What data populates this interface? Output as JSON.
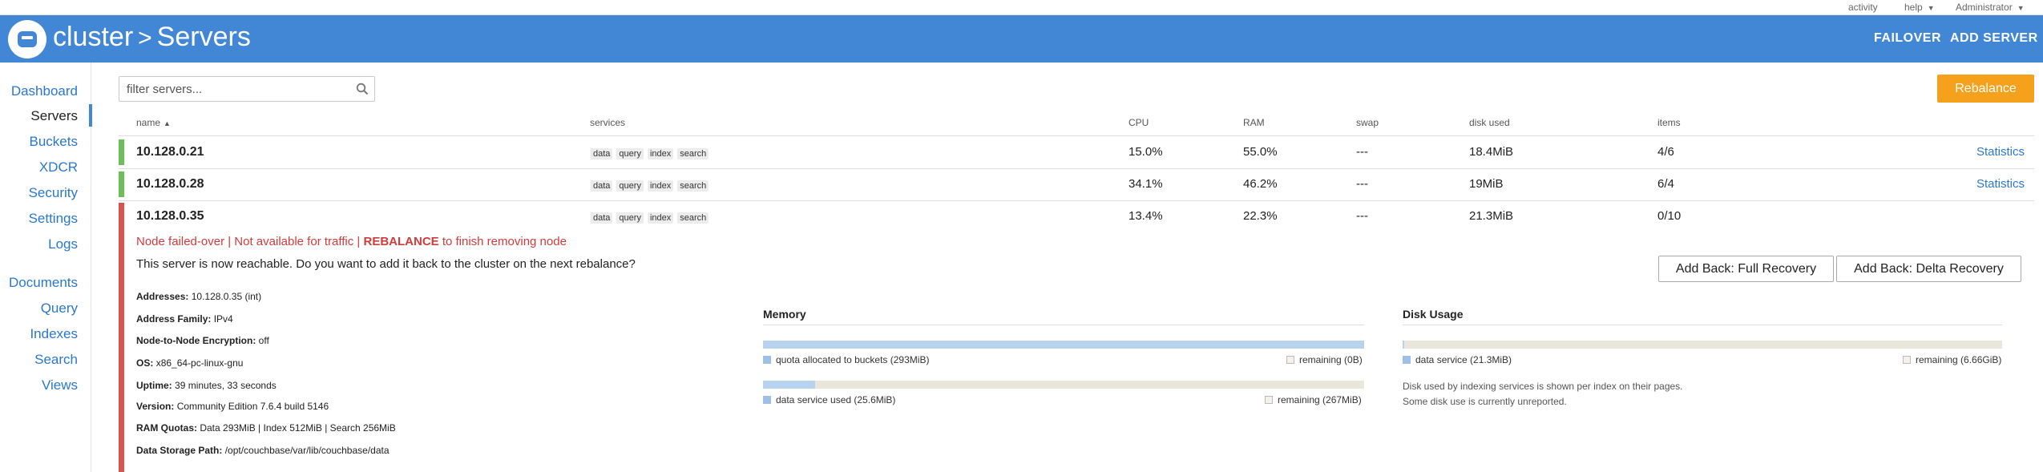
{
  "topbar": {
    "activity": "activity",
    "help": "help",
    "user": "Administrator"
  },
  "header": {
    "cluster": "cluster",
    "separator": ">",
    "page": "Servers",
    "failover": "FAILOVER",
    "add_server": "ADD SERVER"
  },
  "nav": {
    "items": [
      {
        "label": "Dashboard"
      },
      {
        "label": "Servers"
      },
      {
        "label": "Buckets"
      },
      {
        "label": "XDCR"
      },
      {
        "label": "Security"
      },
      {
        "label": "Settings"
      },
      {
        "label": "Logs"
      },
      {
        "label": "Documents"
      },
      {
        "label": "Query"
      },
      {
        "label": "Indexes"
      },
      {
        "label": "Search"
      },
      {
        "label": "Views"
      }
    ],
    "active": "Servers"
  },
  "filter": {
    "placeholder": "filter servers..."
  },
  "rebalance_label": "Rebalance",
  "columns": {
    "name": "name",
    "services": "services",
    "cpu": "CPU",
    "ram": "RAM",
    "swap": "swap",
    "disk": "disk used",
    "items": "items"
  },
  "servers": [
    {
      "name": "10.128.0.21",
      "services": [
        "data",
        "query",
        "index",
        "search"
      ],
      "cpu": "15.0%",
      "ram": "55.0%",
      "swap": "---",
      "disk": "18.4MiB",
      "items": "4/6",
      "stats": "Statistics",
      "status_color": "#6cbf5a"
    },
    {
      "name": "10.128.0.28",
      "services": [
        "data",
        "query",
        "index",
        "search"
      ],
      "cpu": "34.1%",
      "ram": "46.2%",
      "swap": "---",
      "disk": "19MiB",
      "items": "6/4",
      "stats": "Statistics",
      "status_color": "#6cbf5a"
    },
    {
      "name": "10.128.0.35",
      "services": [
        "data",
        "query",
        "index",
        "search"
      ],
      "cpu": "13.4%",
      "ram": "22.3%",
      "swap": "---",
      "disk": "21.3MiB",
      "items": "0/10",
      "status_color": "#d9534f"
    }
  ],
  "failed": {
    "msg_part1": "Node failed-over | Not available for traffic | ",
    "msg_bold": "REBALANCE",
    "msg_part2": " to finish removing node",
    "question": "This server is now reachable. Do you want to add it back to the cluster on the next rebalance?",
    "full_recovery": "Add Back: Full Recovery",
    "delta_recovery": "Add Back: Delta Recovery",
    "details": [
      {
        "label": "Addresses:",
        "value": "10.128.0.35 (int)"
      },
      {
        "label": "Address Family:",
        "value": "IPv4"
      },
      {
        "label": "Node-to-Node Encryption:",
        "value": "off"
      },
      {
        "label": "OS:",
        "value": "x86_64-pc-linux-gnu"
      },
      {
        "label": "Uptime:",
        "value": "39 minutes, 33 seconds"
      },
      {
        "label": "Version:",
        "value": "Community Edition 7.6.4 build 5146"
      },
      {
        "label": "RAM Quotas:",
        "value": "Data 293MiB | Index 512MiB | Search 256MiB"
      },
      {
        "label": "Data Storage Path:",
        "value": "/opt/couchbase/var/lib/couchbase/data"
      }
    ]
  },
  "memory": {
    "title": "Memory",
    "bar1": {
      "fill": 1.0,
      "left_label": "quota allocated to buckets (293MiB)",
      "right_label": "remaining (0B)"
    },
    "bar2": {
      "fill": 0.087,
      "left_label": "data service used (25.6MiB)",
      "right_label": "remaining (267MiB)"
    }
  },
  "disk": {
    "title": "Disk Usage",
    "bar1": {
      "fill": 0.003,
      "left_label": "data service (21.3MiB)",
      "right_label": "remaining (6.66GiB)"
    },
    "note1": "Disk used by indexing services is shown per index on their pages.",
    "note2": "Some disk use is currently unreported."
  },
  "colors": {
    "header": "#4287d6",
    "rebalance": "#f5a11c",
    "healthy": "#6cbf5a",
    "failed": "#d9534f",
    "link": "#2a78cc"
  }
}
